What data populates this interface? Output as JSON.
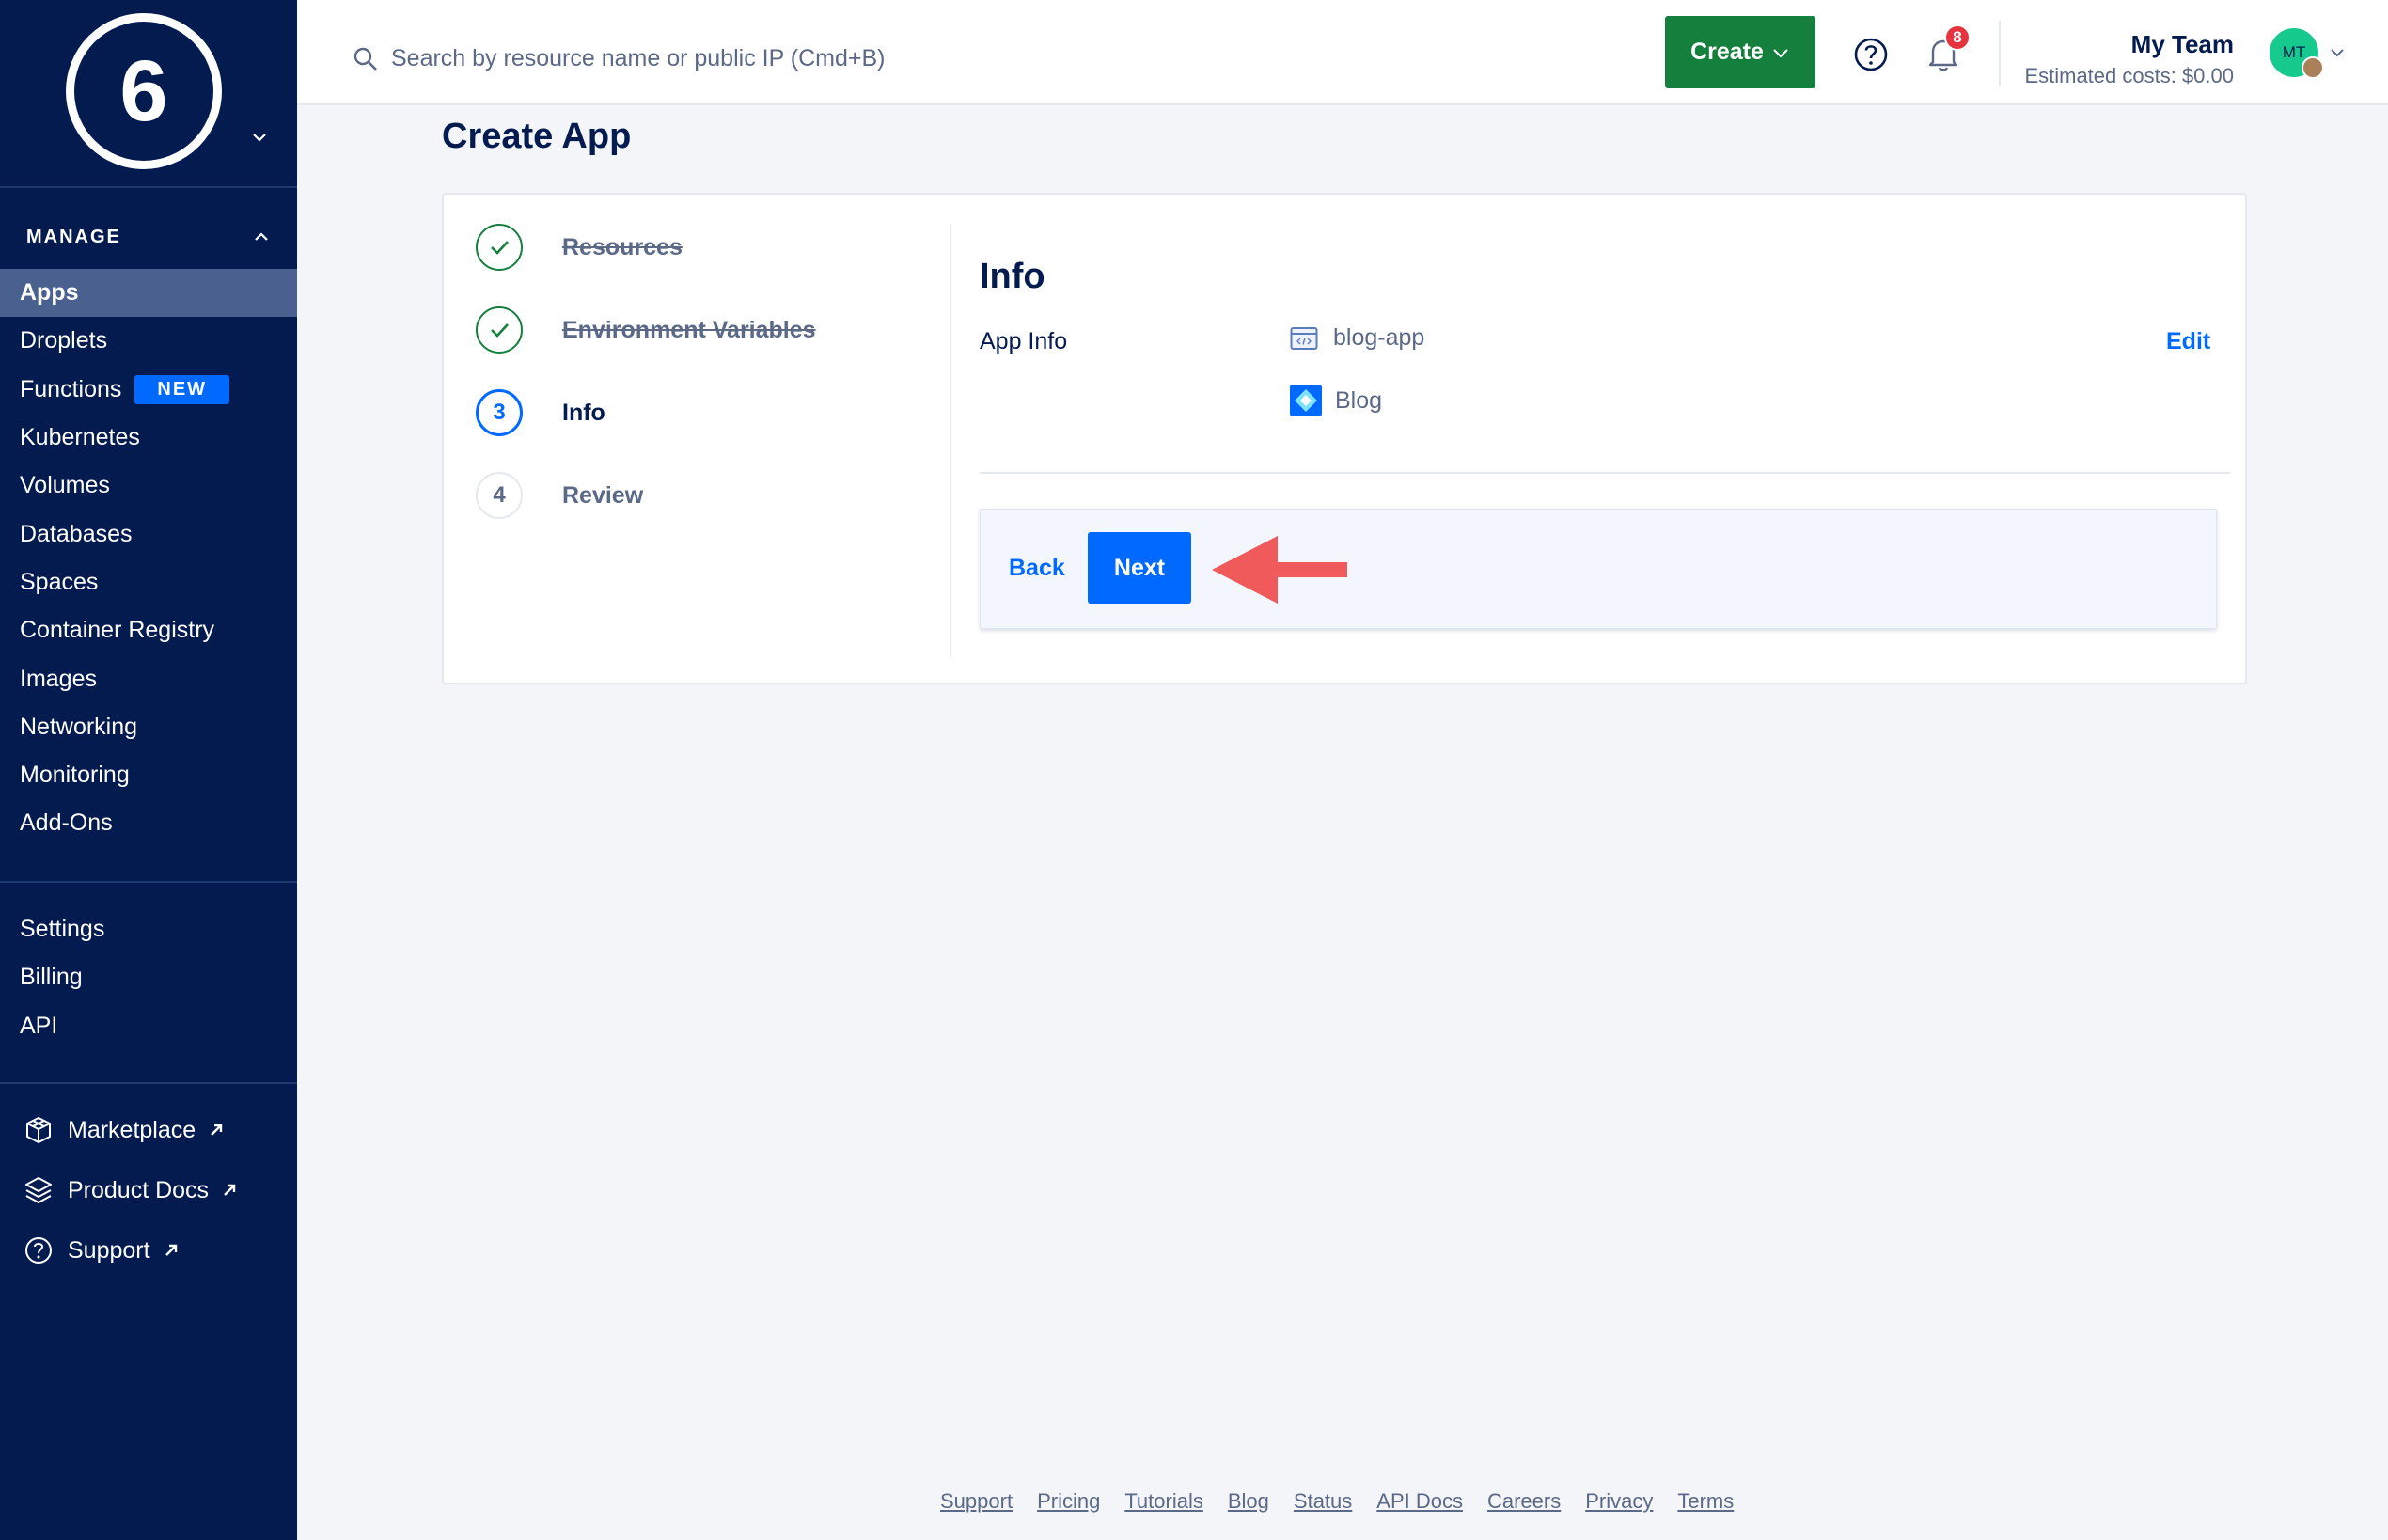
{
  "sidebar": {
    "logo_number": "6",
    "section_title": "MANAGE",
    "items": [
      {
        "label": "Apps"
      },
      {
        "label": "Droplets"
      },
      {
        "label": "Functions",
        "badge": "NEW"
      },
      {
        "label": "Kubernetes"
      },
      {
        "label": "Volumes"
      },
      {
        "label": "Databases"
      },
      {
        "label": "Spaces"
      },
      {
        "label": "Container Registry"
      },
      {
        "label": "Images"
      },
      {
        "label": "Networking"
      },
      {
        "label": "Monitoring"
      },
      {
        "label": "Add-Ons"
      }
    ],
    "secondary": [
      {
        "label": "Settings"
      },
      {
        "label": "Billing"
      },
      {
        "label": "API"
      }
    ],
    "external": [
      {
        "label": "Marketplace",
        "icon": "cube-icon"
      },
      {
        "label": "Product Docs",
        "icon": "layers-icon"
      },
      {
        "label": "Support",
        "icon": "help-circle-icon"
      }
    ]
  },
  "topbar": {
    "search_placeholder": "Search by resource name or public IP (Cmd+B)",
    "create_label": "Create",
    "notification_count": "8",
    "team_name": "My Team",
    "estimated_costs": "Estimated costs: $0.00",
    "avatar_initials": "MT"
  },
  "main": {
    "page_title": "Create App",
    "steps": [
      {
        "number": "",
        "label": "Resources",
        "state": "done"
      },
      {
        "number": "",
        "label": "Environment Variables",
        "state": "done"
      },
      {
        "number": "3",
        "label": "Info",
        "state": "current"
      },
      {
        "number": "4",
        "label": "Review",
        "state": "todo"
      }
    ],
    "info": {
      "title": "Info",
      "app_info_label": "App Info",
      "app_name": "blog-app",
      "app_type": "Blog",
      "edit_label": "Edit"
    },
    "actions": {
      "back_label": "Back",
      "next_label": "Next"
    }
  },
  "footer": {
    "links": [
      "Support",
      "Pricing",
      "Tutorials",
      "Blog",
      "Status",
      "API Docs",
      "Careers",
      "Privacy",
      "Terms"
    ]
  },
  "colors": {
    "sidebar_bg": "#031b4e",
    "primary_blue": "#0069ff",
    "create_green": "#15803d",
    "annotation_red": "#f05a5a"
  }
}
